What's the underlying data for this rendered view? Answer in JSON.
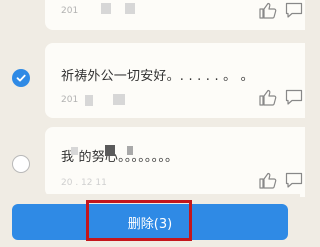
{
  "posts": [
    {
      "title": "",
      "date": "201",
      "selected": null
    },
    {
      "title": "祈祷外公一切安好。. . .   .   .   。   。",
      "date": "201",
      "selected": true
    },
    {
      "title": "我           的努心。。。。。。。。",
      "date": "20 . 12 11",
      "selected": false
    }
  ],
  "icons": {
    "like": "thumbs-up-icon",
    "comment": "comment-icon",
    "check": "check-icon"
  },
  "delete_button": {
    "label": "删除(3)"
  },
  "colors": {
    "accent": "#2f8ae5",
    "highlight": "#c4161c",
    "background": "#f0ece4",
    "card": "#fdfcf8"
  }
}
